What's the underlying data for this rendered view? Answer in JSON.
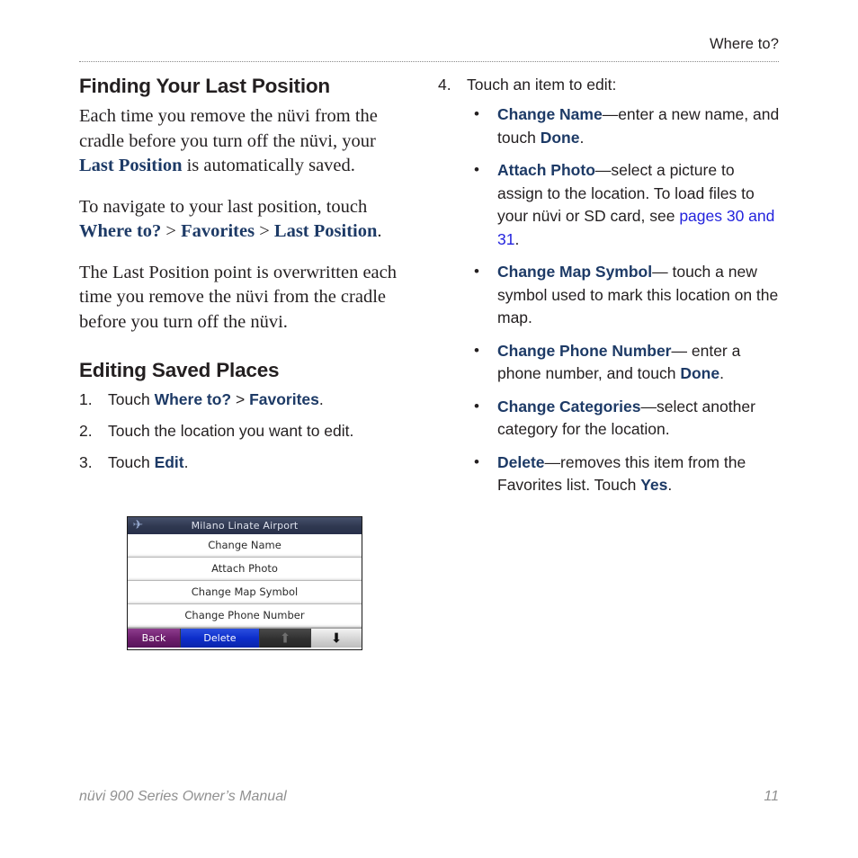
{
  "header": {
    "title": "Where to?"
  },
  "left_column": {
    "heading_1": "Finding Your Last Position",
    "para_1": {
      "t1": "Each time you remove the nüvi from the cradle before you turn off the nüvi, your ",
      "nav1": "Last Position",
      "t2": " is automatically saved."
    },
    "para_2": {
      "t1": "To navigate to your last position, touch ",
      "nav1": "Where to?",
      "sep1": " > ",
      "nav2": "Favorites",
      "sep2": " > ",
      "nav3": "Last Position",
      "t2": "."
    },
    "para_3": "The Last Position point is overwritten each time you remove the nüvi from the cradle before you turn off the nüvi.",
    "heading_2": "Editing Saved Places",
    "steps": [
      {
        "num": "1.",
        "t1": "Touch ",
        "nav1": "Where to?",
        "sep1": " > ",
        "nav2": "Favorites",
        "t2": "."
      },
      {
        "num": "2.",
        "t1": "Touch the location you want to edit.",
        "nav1": "",
        "sep1": "",
        "nav2": "",
        "t2": ""
      },
      {
        "num": "3.",
        "t1": "Touch ",
        "nav1": "Edit",
        "sep1": "",
        "nav2": "",
        "t2": "."
      }
    ]
  },
  "right_column": {
    "step_4": {
      "num": "4.",
      "text": "Touch an item to edit:"
    },
    "bullets": [
      {
        "bullet": "•",
        "term": "Change Name",
        "t1": "—enter a new name, and touch ",
        "term2": "Done",
        "t2": ".",
        "xref": ""
      },
      {
        "bullet": "•",
        "term": "Attach Photo",
        "t1": "—select a picture to assign to the location. To load files to your nüvi or SD card, see ",
        "xref": "pages 30 and 31",
        "term2": "",
        "t2": "."
      },
      {
        "bullet": "•",
        "term": "Change Map Symbol",
        "t1": "— touch a new symbol used to mark this location on the map.",
        "term2": "",
        "t2": "",
        "xref": ""
      },
      {
        "bullet": "•",
        "term": "Change Phone Number",
        "t1": "— enter a phone number, and touch ",
        "term2": "Done",
        "t2": ".",
        "xref": ""
      },
      {
        "bullet": "•",
        "term": "Change Categories",
        "t1": "—select another category for the location.",
        "term2": "",
        "t2": "",
        "xref": ""
      },
      {
        "bullet": "•",
        "term": "Delete",
        "t1": "—removes this item from the Favorites list. Touch ",
        "term2": "Yes",
        "t2": ".",
        "xref": ""
      }
    ]
  },
  "figure": {
    "title": "Milano Linate Airport",
    "title_icon": "airplane-icon",
    "rows": [
      "Change Name",
      "Attach Photo",
      "Change Map Symbol",
      "Change Phone Number"
    ],
    "buttons": {
      "back": "Back",
      "delete": "Delete",
      "scroll_up_icon": "arrow-up-icon",
      "scroll_down_icon": "arrow-down-icon"
    }
  },
  "footer": {
    "manual_title": "nüvi 900 Series Owner’s Manual",
    "page_number": "11"
  },
  "colors": {
    "nav_term": "#1d3a66",
    "cross_reference": "#2323dd",
    "body_text": "#231f20",
    "footer_text": "#909090",
    "device_title_bar": "#2f3850",
    "device_back_button": "#6e1f6e",
    "device_delete_button": "#0d2ecb"
  }
}
